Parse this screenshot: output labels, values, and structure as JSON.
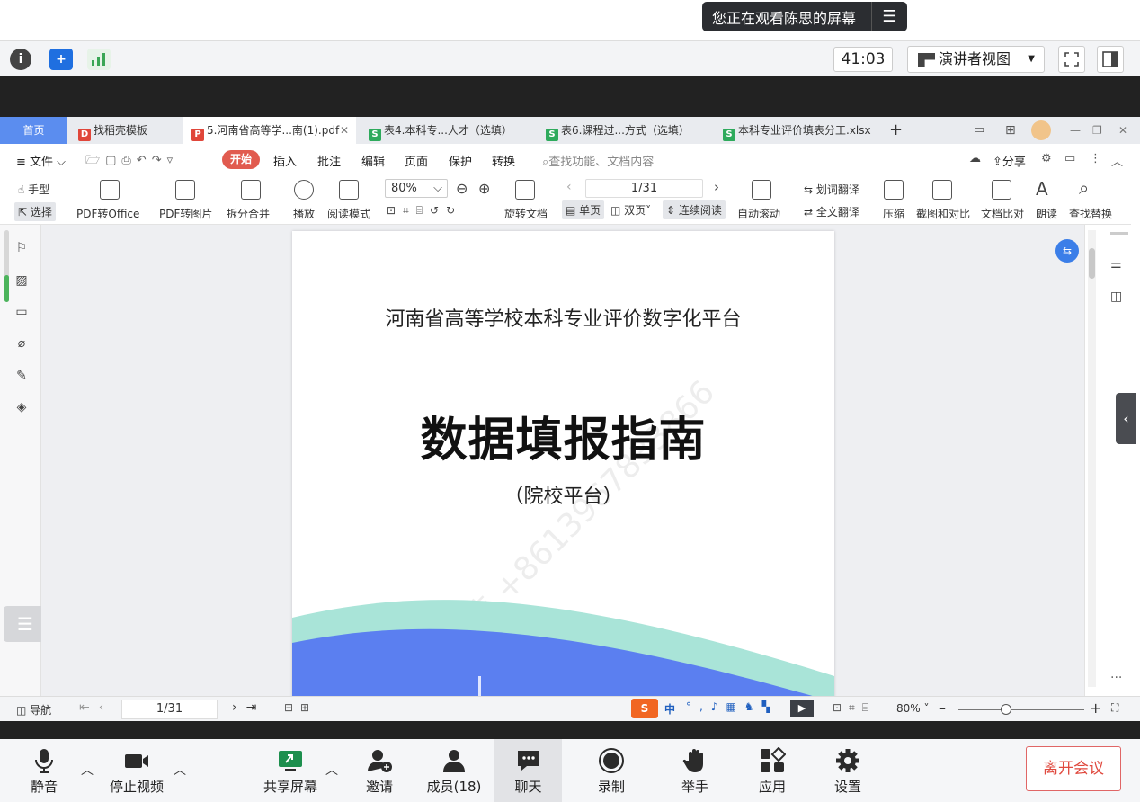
{
  "banner": {
    "text": "您正在观看陈思的屏幕",
    "menu_icon": "list-icon"
  },
  "meeting_toolbar": {
    "timer": "41:03",
    "view_mode": "演讲者视图"
  },
  "wps": {
    "tabs": [
      {
        "label": "首页"
      },
      {
        "label": "找稻壳模板"
      },
      {
        "label": "5.河南省高等学...南(1).pdf"
      },
      {
        "label": "表4.本科专...人才（选填）"
      },
      {
        "label": "表6.课程过...方式（选填）"
      },
      {
        "label": "本科专业评价填表分工.xlsx"
      }
    ],
    "menu": {
      "file": "文件",
      "start": "开始",
      "items": [
        "插入",
        "批注",
        "编辑",
        "页面",
        "保护",
        "转换"
      ],
      "search_placeholder": "查找功能、文档内容",
      "share": "分享"
    },
    "ribbon": {
      "hand": "手型",
      "select": "选择",
      "pdf_office": "PDF转Office",
      "pdf_image": "PDF转图片",
      "split": "拆分合并",
      "play": "播放",
      "read_mode": "阅读模式",
      "zoom": "80%",
      "rotate": "旋转文档",
      "page": "1/31",
      "single": "单页",
      "double": "双页",
      "continuous": "连续阅读",
      "auto_scroll": "自动滚动",
      "word_translate": "划词翻译",
      "full_translate": "全文翻译",
      "compress": "压缩",
      "screenshot": "截图和对比",
      "doc_compare": "文档比对",
      "read_aloud": "朗读",
      "find_replace": "查找替换"
    },
    "document": {
      "subtitle": "河南省高等学校本科专业评价数字化平台",
      "title": "数据填报指南",
      "paren": "（院校平台）",
      "watermark": "和伟 +8613967833866"
    },
    "status": {
      "nav": "导航",
      "page": "1/31",
      "zoom": "80%",
      "ime": "中"
    }
  },
  "bottom_bar": {
    "mute": "静音",
    "stop_video": "停止视频",
    "share_screen": "共享屏幕",
    "invite": "邀请",
    "members": "成员(18)",
    "chat": "聊天",
    "record": "录制",
    "raise_hand": "举手",
    "apps": "应用",
    "settings": "设置",
    "leave": "离开会议"
  }
}
